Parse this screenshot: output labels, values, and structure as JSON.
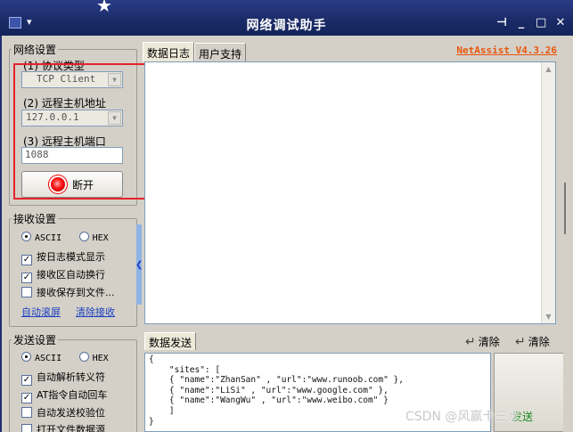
{
  "window": {
    "title": "网络调试助手",
    "controls": [
      "pin",
      "minimize",
      "maximize",
      "close"
    ]
  },
  "network": {
    "group_title": "网络设置",
    "protocol_label": "(1) 协议类型",
    "protocol_value": "TCP Client",
    "host_label": "(2) 远程主机地址",
    "host_value": "127.0.0.1",
    "port_label": "(3) 远程主机端口",
    "port_value": "1088",
    "connect_button": "断开",
    "status_led_color": "#ff1010"
  },
  "receive": {
    "group_title": "接收设置",
    "mode_ascii": "ASCII",
    "mode_hex": "HEX",
    "mode_selected": "ASCII",
    "opt_log_mode": "按日志模式显示",
    "opt_log_mode_checked": true,
    "opt_auto_wrap": "接收区自动换行",
    "opt_auto_wrap_checked": true,
    "opt_save_file": "接收保存到文件...",
    "opt_save_file_checked": false,
    "link_autoscroll": "自动滚屏",
    "link_clear": "清除接收"
  },
  "send": {
    "group_title": "发送设置",
    "mode_ascii": "ASCII",
    "mode_hex": "HEX",
    "mode_selected": "ASCII",
    "opt_escape": "自动解析转义符",
    "opt_escape_checked": true,
    "opt_at_crlf": "AT指令自动回车",
    "opt_at_crlf_checked": true,
    "opt_checksum": "自动发送校验位",
    "opt_checksum_checked": false,
    "opt_open_file": "打开文件数据源",
    "opt_open_file_checked": false
  },
  "tabs": [
    "数据日志",
    "用户支持"
  ],
  "brand": "NetAssist V4.3.26",
  "send_panel": {
    "tab": "数据发送",
    "clear1": "清除",
    "clear2": "清除",
    "button": "发送",
    "content": "{\n    \"sites\": [\n    { \"name\":\"ZhanSan\" , \"url\":\"www.runoob.com\" },\n    { \"name\":\"LiSi\" , \"url\":\"www.google.com\" },\n    { \"name\":\"WangWu\" , \"url\":\"www.weibo.com\" }\n    ]\n}"
  },
  "watermark": "CSDN @风赢卡三水",
  "colors": {
    "titlebar": "#1a2a66",
    "window_bg": "#d4d0c8",
    "brand": "#e8560c",
    "highlight": "#e4222a",
    "link": "#1a3fc0"
  }
}
